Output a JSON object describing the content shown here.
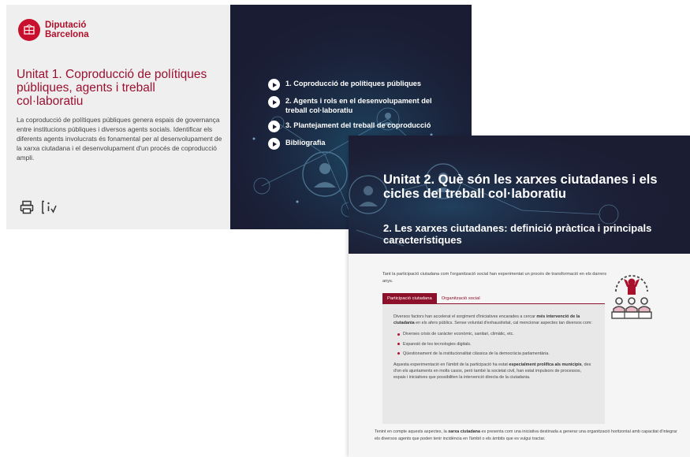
{
  "slide1": {
    "brand": {
      "line1": "Diputació",
      "line2": "Barcelona"
    },
    "title": "Unitat 1. Coproducció de polítiques públiques, agents i treball col·laboratiu",
    "description": "La coproducció de polítiques públiques genera espais de governança entre institucions públiques i diversos agents socials. Identificar els diferents agents involucrats és fonamental per al desenvolupament de la xarxa ciutadana i el desenvolupament d'un procés de coproducció ampli.",
    "tools": [
      {
        "icon": "print-icon"
      },
      {
        "icon": "info-icon"
      }
    ],
    "menu": [
      "1. Coproducció de polítiques públiques",
      "2. Agents i rols en el desenvolupament del treball col·laboratiu",
      "3. Plantejament del treball de coproducció",
      "Bibliografia"
    ]
  },
  "slide2": {
    "title": "Unitat 2. Què són les xarxes ciutadanes i els cicles del treball col·laboratiu",
    "subtitle": "2. Les xarxes ciutadanes: definició pràctica i principals característiques",
    "intro": "Tant la participació ciutadana com l'organització social han experimentat un procés de transformació en els darrers anys.",
    "tabs": [
      "Participació ciutadana",
      "Organització social"
    ],
    "panel": {
      "p1_a": "Diversos factors han accelerat el sorgiment d'iniciatives encarades a cercar ",
      "p1_b": "més intervenció de la ciutadania",
      "p1_c": " en els afers públics. Sense voluntat d'exhaustivitat, cal mencionar aspectes tan diversos com:",
      "bullets": [
        "Diverses crisis de caràcter econòmic, sanitari, climàtic, etc.",
        "Expansió de les tecnologies digitals.",
        "Qüestionament de la institucionalitat clàssica de la democràcia parlamentària."
      ],
      "p2_a": "Aquesta experimentació en l'àmbit de la participació ha estat ",
      "p2_b": "especialment prolífica als municipis",
      "p2_c": ", des d'on els ajuntaments en molts casos, però també la societat civil, han estat impulsors de processos, espais i iniciatives que possibiliten la intervenció directa de la ciutadania."
    },
    "outro": {
      "a": "Tenint en compte aquests aspectes, la ",
      "b": "xarxa ciutadana",
      "c": " es presenta com una iniciativa destinada a generar una organització horitzontal amb capacitat d'integrar els diversos agents que poden tenir incidència en l'àmbit o els àmbits que es vulgui tractar."
    },
    "illustration": "people-network-icon"
  },
  "colors": {
    "brand_red": "#c8102e",
    "title_red": "#9c1030",
    "tab_red": "#8c1029",
    "dark_navy": "#1a1c33"
  }
}
